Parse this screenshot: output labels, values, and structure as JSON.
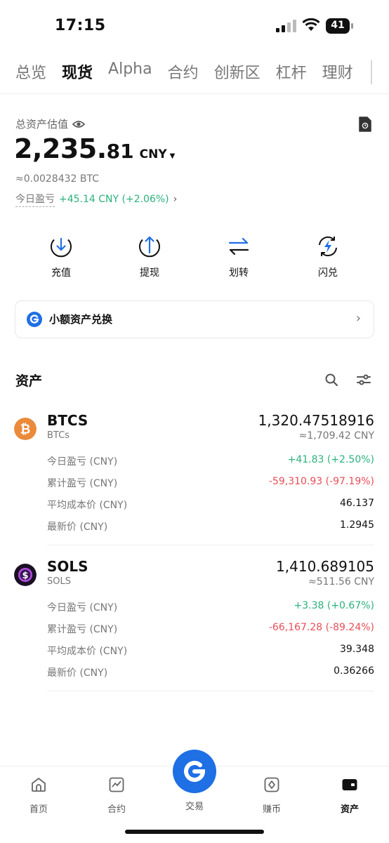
{
  "status_bar": {
    "time": "17:15",
    "battery": "41"
  },
  "tabs": [
    "总览",
    "现货",
    "Alpha",
    "合约",
    "创新区",
    "杠杆",
    "理财"
  ],
  "active_tab": "现货",
  "overview": {
    "label": "总资产估值",
    "value_int": "2,235.",
    "value_dec": "81",
    "currency": "CNY",
    "btc_equiv": "≈0.0028432 BTC",
    "today_pnl_label": "今日盈亏",
    "today_pnl_value": "+45.14 CNY (+2.06%)"
  },
  "actions": [
    {
      "label": "充值",
      "icon": "deposit-icon"
    },
    {
      "label": "提现",
      "icon": "withdraw-icon"
    },
    {
      "label": "划转",
      "icon": "transfer-icon"
    },
    {
      "label": "闪兑",
      "icon": "flash-swap-icon"
    }
  ],
  "small_asset_card": {
    "label": "小额资产兑换"
  },
  "assets_section": {
    "title": "资产"
  },
  "assets": [
    {
      "symbol": "BTCS",
      "name": "BTCs",
      "amount": "1,320.47518916",
      "approx": "≈1,709.42 CNY",
      "rows": [
        {
          "label": "今日盈亏 (CNY)",
          "value": "+41.83 (+2.50%)"
        },
        {
          "label": "累计盈亏 (CNY)",
          "value": "-59,310.93 (-97.19%)"
        },
        {
          "label": "平均成本价 (CNY)",
          "value": "46.137"
        },
        {
          "label": "最新价 (CNY)",
          "value": "1.2945"
        }
      ]
    },
    {
      "symbol": "SOLS",
      "name": "SOLS",
      "amount": "1,410.689105",
      "approx": "≈511.56 CNY",
      "rows": [
        {
          "label": "今日盈亏 (CNY)",
          "value": "+3.38 (+0.67%)"
        },
        {
          "label": "累计盈亏 (CNY)",
          "value": "-66,167.28 (-89.24%)"
        },
        {
          "label": "平均成本价 (CNY)",
          "value": "39.348"
        },
        {
          "label": "最新价 (CNY)",
          "value": "0.36266"
        }
      ]
    }
  ],
  "bottom_nav": [
    "首页",
    "合约",
    "交易",
    "赚币",
    "资产"
  ],
  "colors": {
    "accent": "#1f6fe5",
    "positive": "#2ab27b",
    "negative": "#e84e57"
  }
}
